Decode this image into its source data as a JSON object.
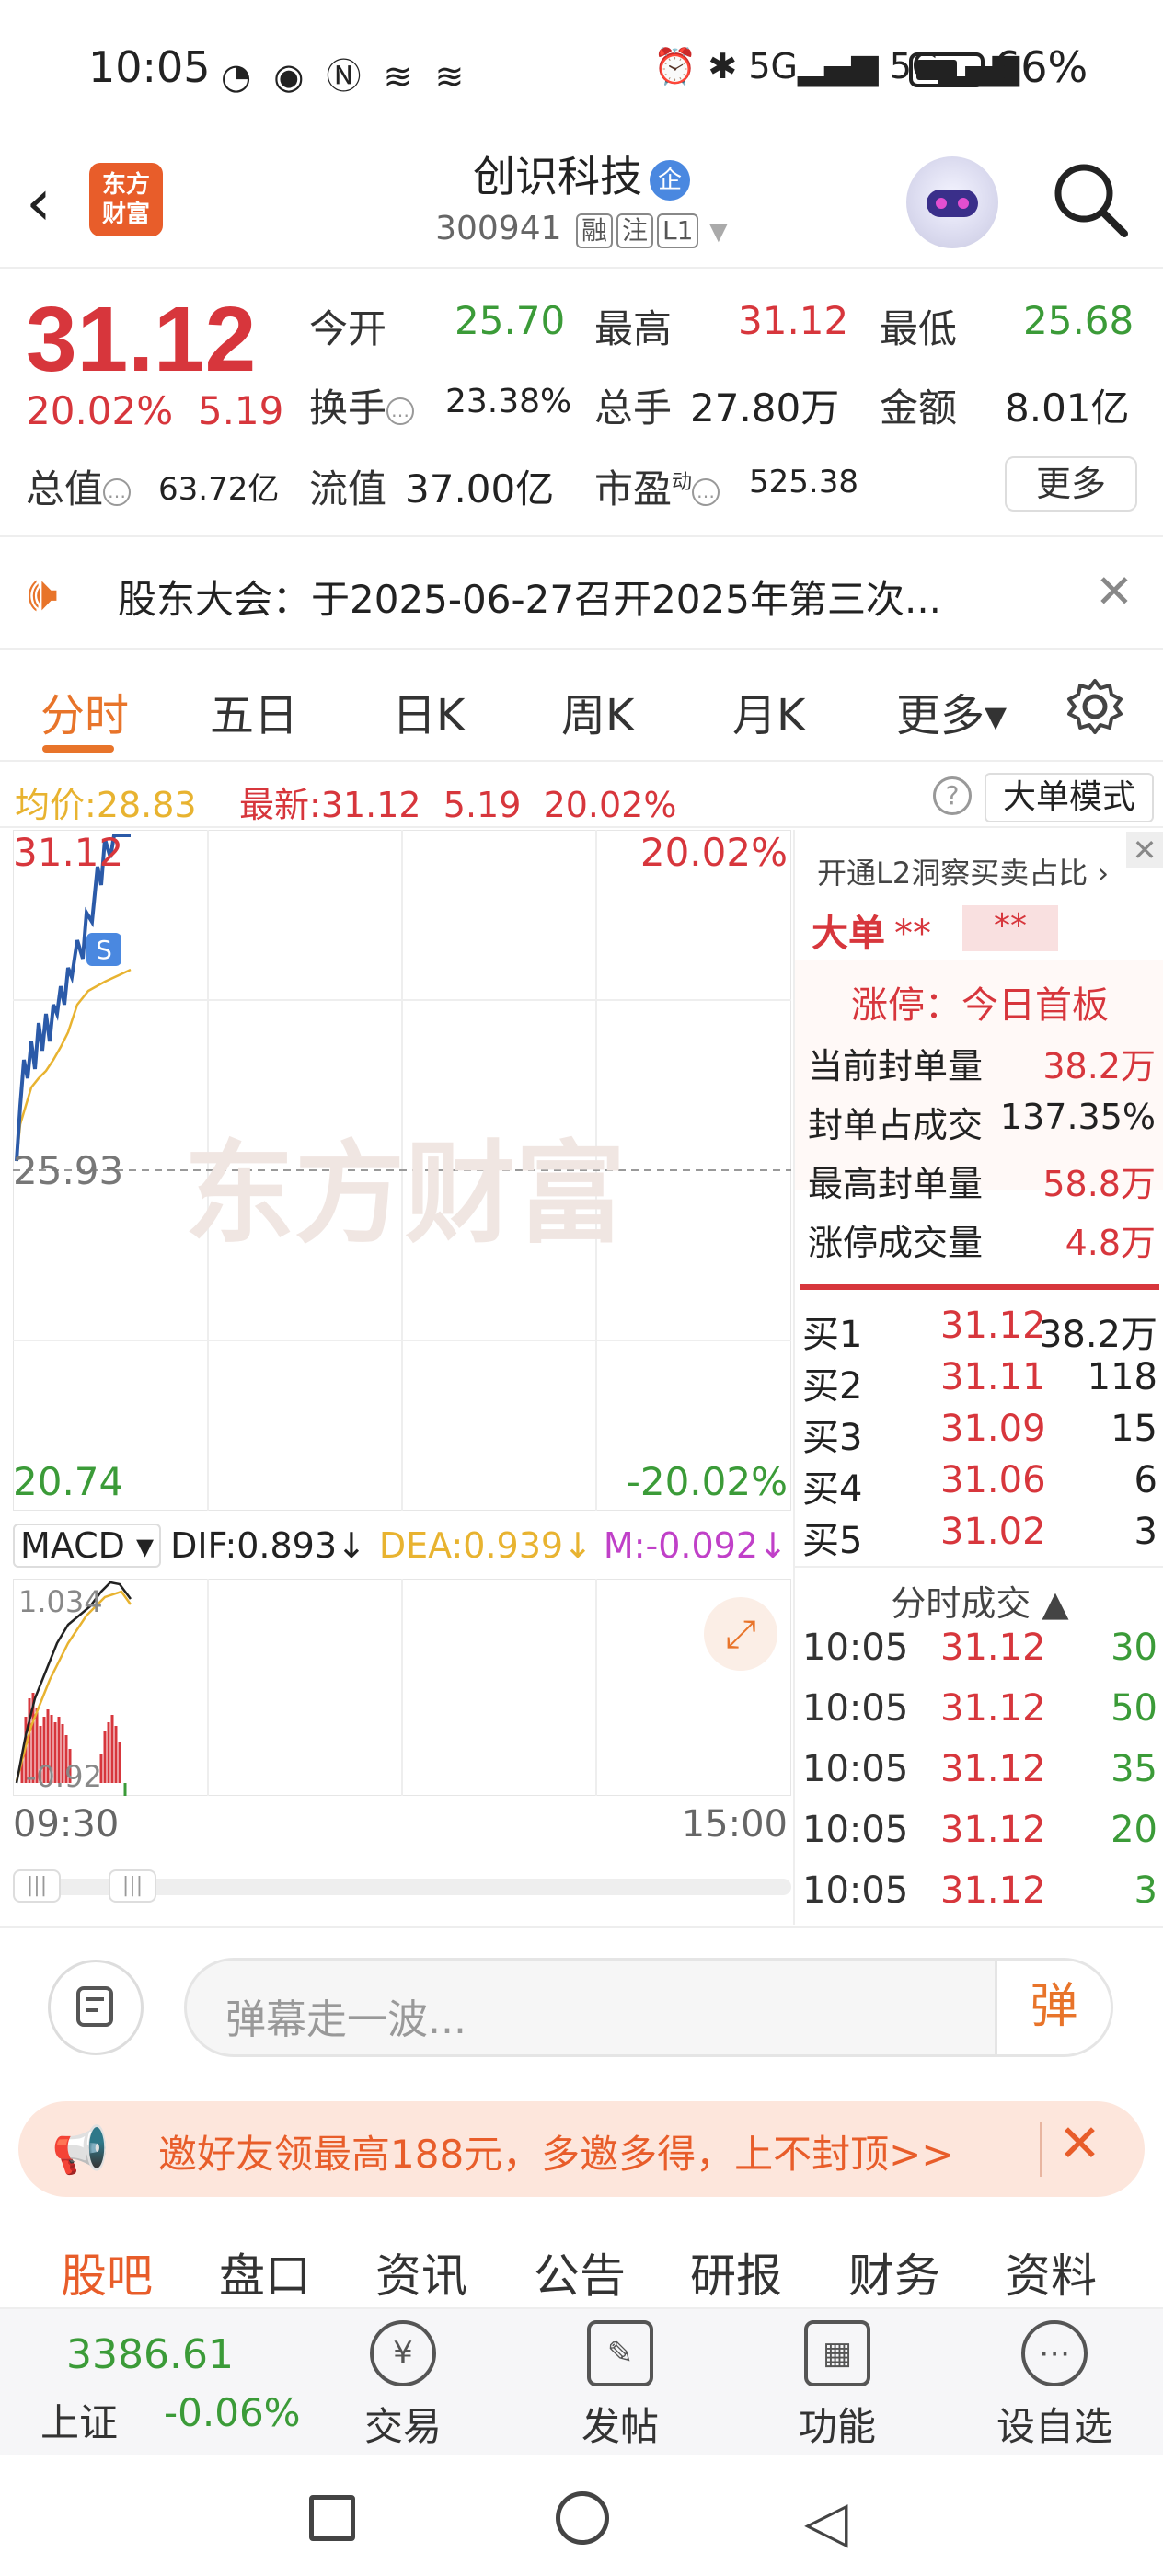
{
  "status": {
    "time": "10:05",
    "net1": "5G",
    "net2": "5G",
    "battery": "66%",
    "battery_level": 0.66
  },
  "header": {
    "title": "创识科技",
    "qi_badge": "企",
    "code": "300941",
    "tags": [
      "融",
      "注",
      "L1"
    ],
    "logo_line1": "东方",
    "logo_line2": "财富"
  },
  "quote": {
    "price": "31.12",
    "pct": "20.02%",
    "chg": "5.19",
    "open_label": "今开",
    "open": "25.70",
    "high_label": "最高",
    "high": "31.12",
    "low_label": "最低",
    "low": "25.68",
    "turnover_label": "换手",
    "turnover": "23.38%",
    "volume_label": "总手",
    "volume": "27.80万",
    "amount_label": "金额",
    "amount": "8.01亿",
    "mktcap_label": "总值",
    "mktcap": "63.72亿",
    "float_label": "流值",
    "float": "37.00亿",
    "pe_label": "市盈",
    "pe_sup": "动",
    "pe": "525.38",
    "more": "更多"
  },
  "notice": {
    "text": "股东大会：于2025-06-27召开2025年第三次..."
  },
  "tabs": [
    "分时",
    "五日",
    "日K",
    "周K",
    "月K",
    "更多▾"
  ],
  "avgrow": {
    "avg_label": "均价:",
    "avg": "28.83",
    "last_label": "最新:",
    "last": "31.12",
    "chg": "5.19",
    "pct": "20.02%",
    "mode": "大单模式"
  },
  "chart": {
    "top_price": "31.12",
    "top_pct": "20.02%",
    "mid_price": "25.93",
    "bot_price": "20.74",
    "bot_pct": "-20.02%",
    "watermark": "东方财富",
    "s_marker": "S"
  },
  "macd": {
    "name": "MACD ▾",
    "dif": "DIF:0.893↓",
    "dea": "DEA:0.939↓",
    "m": "M:-0.092↓",
    "top": "1.034",
    "bot": "-0.92"
  },
  "time_axis": {
    "start": "09:30",
    "end": "15:00"
  },
  "panel": {
    "l2": "开通L2洞察买卖占比 ›",
    "big_label": "大单",
    "big_star1": "**",
    "big_star2": "**",
    "limit_title": "涨停：今日首板",
    "rows": [
      {
        "k": "当前封单量",
        "v": "38.2万"
      },
      {
        "k": "封单占成交",
        "v": "137.35%"
      },
      {
        "k": "最高封单量",
        "v": "58.8万"
      },
      {
        "k": "涨停成交量",
        "v": "4.8万"
      }
    ],
    "bids": [
      {
        "k": "买1",
        "p": "31.12",
        "q": "38.2万"
      },
      {
        "k": "买2",
        "p": "31.11",
        "q": "118"
      },
      {
        "k": "买3",
        "p": "31.09",
        "q": "15"
      },
      {
        "k": "买4",
        "p": "31.06",
        "q": "6"
      },
      {
        "k": "买5",
        "p": "31.02",
        "q": "3"
      }
    ],
    "ticks_title": "分时成交 ▲",
    "ticks": [
      {
        "t": "10:05",
        "p": "31.12",
        "q": "30"
      },
      {
        "t": "10:05",
        "p": "31.12",
        "q": "50"
      },
      {
        "t": "10:05",
        "p": "31.12",
        "q": "35"
      },
      {
        "t": "10:05",
        "p": "31.12",
        "q": "20"
      },
      {
        "t": "10:05",
        "p": "31.12",
        "q": "3"
      }
    ]
  },
  "comment": {
    "placeholder": "弹幕走一波...",
    "btn": "弹"
  },
  "promo": {
    "text": "邀好友领最高188元，多邀多得，上不封顶>>"
  },
  "subtabs": [
    "股吧",
    "盘口",
    "资讯",
    "公告",
    "研报",
    "财务",
    "资料"
  ],
  "bottom": {
    "index_value": "3386.61",
    "index_name": "上证",
    "index_chg": "-0.06%",
    "items": [
      "交易",
      "发帖",
      "功能",
      "设自选"
    ]
  },
  "colors": {
    "up": "#d7363c",
    "down": "#3b9b38",
    "accent": "#e8742a",
    "price_line": "#2b5aa8",
    "avg_line": "#e8b330"
  }
}
